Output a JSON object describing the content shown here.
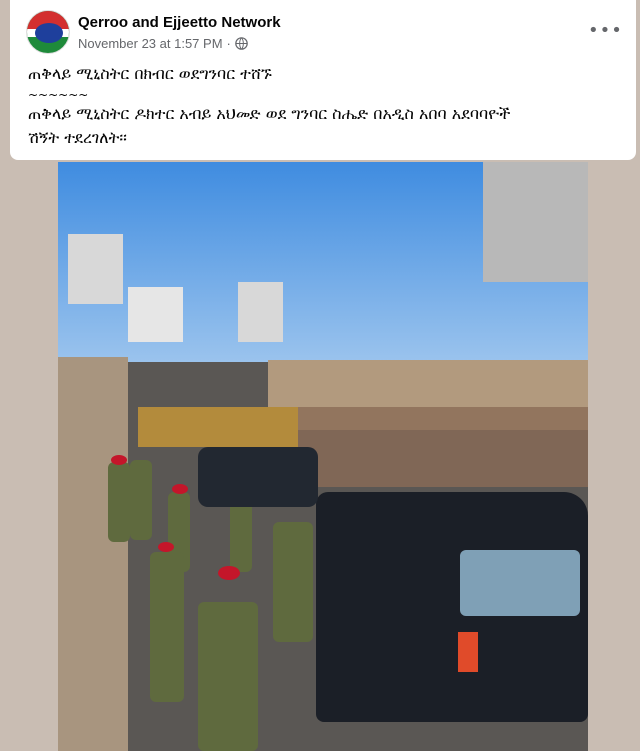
{
  "post": {
    "author": "Qerroo and Ejjeetto Network",
    "timestamp": "November 23 at 1:57 PM",
    "separator": "·",
    "privacy_icon": "globe-icon",
    "more_label": "•••",
    "text_line1": "ጠቅላይ ሚኒስትር በክብር ወደግንባር ተሸኙ",
    "text_line2": "~~~~~~",
    "text_line3": "ጠቅላይ ሚኒስትር ዶክተር አብይ አህመድ ወደ ግንባር  ስሔድ በአዲስ አበባ አደባባዮች",
    "text_line4": "ሽኝት ተደረገለት፡፡"
  },
  "colors": {
    "background": "#c9bdb3",
    "card": "#ffffff",
    "name": "#050505",
    "meta": "#65676b",
    "beret": "#c4162a"
  }
}
